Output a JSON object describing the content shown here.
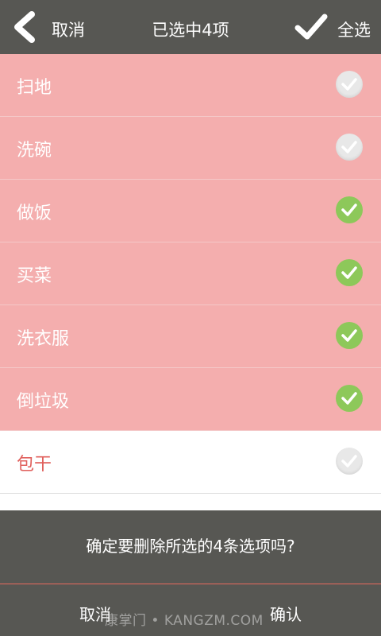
{
  "header": {
    "cancel_label": "取消",
    "title": "已选中4项",
    "select_all_label": "全选"
  },
  "items": [
    {
      "label": "扫地",
      "checked": false
    },
    {
      "label": "洗碗",
      "checked": false
    },
    {
      "label": "做饭",
      "checked": true
    },
    {
      "label": "买菜",
      "checked": true
    },
    {
      "label": "洗衣服",
      "checked": true
    },
    {
      "label": "倒垃圾",
      "checked": true
    },
    {
      "label": "包干",
      "checked": false
    }
  ],
  "dialog": {
    "message": "确定要删除所选的4条选项吗?",
    "cancel_label": "取消",
    "confirm_label": "确认"
  },
  "watermark": "康掌门 • KANGZM.COM",
  "colors": {
    "bar": "#575753",
    "selected_row": "#f4aeae",
    "check_on": "#8dc85a",
    "accent_text": "#e0605c"
  }
}
